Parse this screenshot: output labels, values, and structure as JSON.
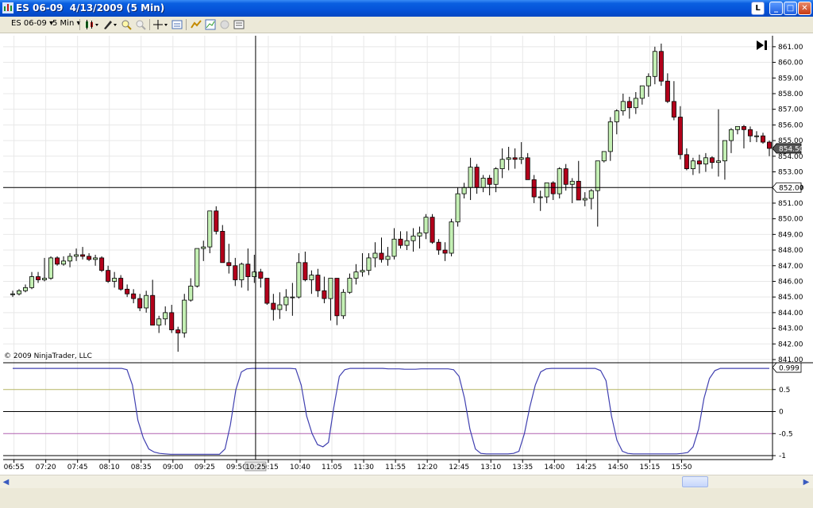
{
  "window": {
    "title": "ES 06-09  4/13/2009 (5 Min)",
    "button_l": "L",
    "minimize": "_",
    "maximize": "□",
    "close": "✕"
  },
  "toolbar": {
    "instrument": "ES 06-09",
    "interval": "5 Min",
    "icons": [
      "chart-style-icon",
      "drawing-pencil-icon",
      "zoom-in-icon",
      "zoom-out-icon",
      "crosshair-icon",
      "data-box-icon",
      "indicators-icon",
      "strategies-icon",
      "chart-trader-icon",
      "properties-icon"
    ]
  },
  "chart": {
    "copyright": "© 2009 NinjaTrader, LLC",
    "price_axis_labels": [
      "861.00",
      "860.00",
      "859.00",
      "858.00",
      "857.00",
      "856.00",
      "855.00",
      "854.00",
      "853.00",
      "852.00",
      "851.00",
      "850.00",
      "849.00",
      "848.00",
      "847.00",
      "846.00",
      "845.00",
      "844.00",
      "843.00",
      "842.00",
      "841.00"
    ],
    "last_price_label": "854.50",
    "crosshair_price_label": "852.00",
    "crosshair_time_label": "10:25",
    "time_labels": [
      "06:55",
      "07:20",
      "07:45",
      "08:10",
      "08:35",
      "09:00",
      "09:25",
      "09:50",
      "10:15",
      "10:40",
      "11:05",
      "11:30",
      "11:55",
      "12:20",
      "12:45",
      "13:10",
      "13:35",
      "14:00",
      "14:25",
      "14:50",
      "15:15",
      "15:50"
    ],
    "indicator_labels": [
      "0.999",
      "0.5",
      "0",
      "-0.5",
      "-1"
    ],
    "colors": {
      "up": "#c4f0b4",
      "down": "#b3001b",
      "indicator": "#4040b0",
      "level_high": "#b5b565",
      "level_low": "#b060b0",
      "grid": "#e8e8e8"
    }
  },
  "chart_data": {
    "type": "candlestick",
    "ohlc": [
      [
        845.2,
        845.4,
        845.0,
        845.2
      ],
      [
        845.2,
        845.5,
        845.1,
        845.4
      ],
      [
        845.4,
        845.8,
        845.3,
        845.6
      ],
      [
        845.6,
        846.6,
        845.5,
        846.3
      ],
      [
        846.3,
        846.6,
        845.9,
        846.1
      ],
      [
        846.1,
        847.5,
        846.0,
        846.2
      ],
      [
        846.2,
        847.6,
        846.1,
        847.5
      ],
      [
        847.5,
        847.6,
        847.0,
        847.1
      ],
      [
        847.1,
        847.6,
        847.0,
        847.3
      ],
      [
        847.3,
        847.8,
        846.9,
        847.6
      ],
      [
        847.6,
        848.1,
        847.3,
        847.7
      ],
      [
        847.7,
        848.2,
        847.4,
        847.6
      ],
      [
        847.6,
        847.8,
        847.3,
        847.4
      ],
      [
        847.4,
        847.7,
        847.0,
        847.5
      ],
      [
        847.5,
        847.6,
        846.6,
        846.7
      ],
      [
        846.7,
        847.0,
        845.9,
        846.0
      ],
      [
        846.0,
        846.6,
        845.6,
        846.2
      ],
      [
        846.2,
        846.4,
        845.4,
        845.5
      ],
      [
        845.5,
        845.8,
        845.0,
        845.2
      ],
      [
        845.2,
        845.5,
        844.6,
        844.9
      ],
      [
        844.9,
        845.2,
        844.1,
        844.3
      ],
      [
        844.3,
        845.4,
        844.0,
        845.1
      ],
      [
        845.1,
        846.1,
        843.2,
        843.2
      ],
      [
        843.2,
        843.8,
        842.7,
        843.6
      ],
      [
        843.6,
        844.4,
        843.2,
        844.0
      ],
      [
        844.0,
        844.5,
        842.7,
        842.9
      ],
      [
        842.9,
        843.1,
        841.5,
        842.7
      ],
      [
        842.7,
        845.2,
        842.4,
        844.8
      ],
      [
        844.8,
        846.2,
        844.7,
        845.7
      ],
      [
        845.7,
        848.1,
        845.6,
        848.1
      ],
      [
        848.1,
        848.6,
        847.3,
        848.2
      ],
      [
        848.2,
        850.2,
        847.8,
        850.5
      ],
      [
        850.5,
        850.8,
        849.0,
        849.2
      ],
      [
        849.2,
        849.6,
        847.3,
        847.2
      ],
      [
        847.2,
        848.4,
        846.5,
        847.0
      ],
      [
        847.0,
        847.5,
        845.7,
        846.1
      ],
      [
        846.1,
        847.2,
        845.6,
        847.1
      ],
      [
        847.1,
        848.1,
        845.4,
        846.3
      ],
      [
        846.3,
        847.7,
        845.9,
        846.6
      ],
      [
        846.6,
        846.8,
        845.6,
        846.2
      ],
      [
        846.2,
        846.2,
        844.5,
        844.6
      ],
      [
        844.6,
        845.2,
        843.5,
        844.2
      ],
      [
        844.2,
        845.3,
        843.6,
        844.5
      ],
      [
        844.5,
        845.5,
        844.1,
        845.0
      ],
      [
        845.0,
        845.9,
        843.8,
        845.0
      ],
      [
        845.0,
        847.8,
        844.9,
        847.2
      ],
      [
        847.2,
        847.9,
        846.0,
        846.1
      ],
      [
        846.1,
        846.7,
        845.2,
        846.4
      ],
      [
        846.4,
        846.8,
        845.0,
        845.4
      ],
      [
        845.4,
        846.3,
        844.6,
        844.9
      ],
      [
        844.9,
        846.2,
        843.5,
        846.2
      ],
      [
        846.2,
        846.2,
        843.2,
        843.8
      ],
      [
        843.8,
        845.5,
        843.6,
        845.3
      ],
      [
        845.3,
        846.5,
        845.2,
        846.2
      ],
      [
        846.2,
        847.1,
        845.8,
        846.6
      ],
      [
        846.6,
        847.8,
        846.3,
        846.7
      ],
      [
        846.7,
        847.8,
        846.4,
        847.5
      ],
      [
        847.5,
        848.5,
        846.9,
        847.8
      ],
      [
        847.8,
        848.8,
        847.2,
        847.4
      ],
      [
        847.4,
        848.2,
        847.0,
        847.6
      ],
      [
        847.6,
        849.4,
        847.4,
        848.7
      ],
      [
        848.7,
        849.2,
        848.1,
        848.3
      ],
      [
        848.3,
        849.2,
        848.0,
        848.6
      ],
      [
        848.6,
        849.4,
        847.9,
        848.9
      ],
      [
        848.9,
        849.5,
        848.1,
        849.1
      ],
      [
        849.1,
        850.3,
        848.7,
        850.1
      ],
      [
        850.1,
        850.3,
        848.4,
        848.5
      ],
      [
        848.5,
        848.7,
        847.7,
        848.0
      ],
      [
        848.0,
        848.5,
        847.3,
        847.8
      ],
      [
        847.8,
        850.0,
        847.6,
        849.8
      ],
      [
        849.8,
        852.0,
        849.5,
        851.6
      ],
      [
        851.6,
        852.3,
        851.3,
        852.0
      ],
      [
        852.0,
        853.9,
        851.2,
        853.3
      ],
      [
        853.3,
        853.5,
        851.6,
        852.0
      ],
      [
        852.0,
        852.8,
        851.7,
        852.6
      ],
      [
        852.6,
        852.8,
        851.5,
        852.2
      ],
      [
        852.2,
        853.3,
        851.7,
        853.2
      ],
      [
        853.2,
        854.5,
        852.6,
        853.8
      ],
      [
        853.8,
        854.6,
        853.1,
        853.9
      ],
      [
        853.9,
        854.5,
        853.2,
        853.8
      ],
      [
        853.8,
        854.9,
        853.5,
        853.9
      ],
      [
        853.9,
        854.2,
        852.5,
        852.5
      ],
      [
        852.5,
        852.8,
        851.0,
        851.4
      ],
      [
        851.4,
        851.8,
        850.5,
        851.4
      ],
      [
        851.4,
        852.3,
        851.0,
        852.3
      ],
      [
        852.3,
        852.4,
        851.2,
        851.6
      ],
      [
        851.6,
        853.3,
        851.3,
        853.2
      ],
      [
        853.2,
        853.5,
        851.8,
        852.2
      ],
      [
        852.2,
        852.6,
        851.0,
        852.4
      ],
      [
        852.4,
        853.7,
        851.6,
        851.2
      ],
      [
        851.2,
        851.7,
        850.8,
        851.3
      ],
      [
        851.3,
        851.9,
        850.6,
        851.8
      ],
      [
        851.8,
        852.3,
        849.5,
        853.7
      ],
      [
        853.7,
        854.3,
        853.6,
        854.3
      ],
      [
        854.3,
        856.5,
        853.7,
        856.2
      ],
      [
        856.2,
        857.0,
        855.4,
        856.9
      ],
      [
        856.9,
        858.0,
        856.6,
        857.5
      ],
      [
        857.5,
        857.8,
        856.4,
        857.1
      ],
      [
        857.1,
        858.1,
        856.7,
        857.7
      ],
      [
        857.7,
        858.5,
        857.3,
        858.5
      ],
      [
        858.5,
        859.3,
        857.8,
        859.1
      ],
      [
        859.1,
        861.0,
        858.6,
        860.7
      ],
      [
        860.7,
        861.2,
        858.5,
        858.8
      ],
      [
        858.8,
        859.3,
        857.4,
        857.5
      ],
      [
        857.5,
        858.8,
        856.3,
        856.5
      ],
      [
        856.5,
        857.2,
        853.8,
        854.1
      ],
      [
        854.1,
        854.5,
        853.1,
        853.2
      ],
      [
        853.2,
        853.9,
        852.8,
        853.7
      ],
      [
        853.7,
        854.1,
        852.9,
        853.5
      ],
      [
        853.5,
        854.2,
        853.0,
        853.9
      ],
      [
        853.9,
        854.0,
        853.2,
        853.6
      ],
      [
        853.6,
        857.0,
        852.7,
        853.7
      ],
      [
        853.7,
        854.9,
        852.5,
        855.0
      ],
      [
        855.0,
        855.8,
        854.2,
        855.7
      ],
      [
        855.7,
        855.9,
        855.4,
        855.9
      ],
      [
        855.9,
        856.0,
        854.5,
        855.7
      ],
      [
        855.7,
        855.9,
        854.9,
        855.3
      ],
      [
        855.3,
        855.6,
        854.9,
        855.3
      ],
      [
        855.3,
        855.5,
        854.8,
        854.9
      ],
      [
        854.9,
        855.0,
        854.0,
        854.5
      ]
    ],
    "indicator": [
      0.98,
      0.98,
      0.98,
      0.98,
      0.98,
      0.98,
      0.98,
      0.98,
      0.98,
      0.98,
      0.98,
      0.98,
      0.98,
      0.98,
      0.98,
      0.98,
      0.98,
      0.98,
      0.98,
      0.98,
      0.98,
      0.95,
      0.6,
      -0.2,
      -0.6,
      -0.85,
      -0.92,
      -0.95,
      -0.96,
      -0.97,
      -0.97,
      -0.97,
      -0.97,
      -0.97,
      -0.97,
      -0.97,
      -0.97,
      -0.97,
      -0.97,
      -0.85,
      -0.3,
      0.5,
      0.9,
      0.97,
      0.98,
      0.98,
      0.98,
      0.98,
      0.98,
      0.98,
      0.98,
      0.98,
      0.97,
      0.6,
      -0.1,
      -0.5,
      -0.75,
      -0.8,
      -0.7,
      0.1,
      0.8,
      0.95,
      0.98,
      0.98,
      0.98,
      0.98,
      0.98,
      0.98,
      0.98,
      0.97,
      0.97,
      0.97,
      0.96,
      0.96,
      0.96,
      0.97,
      0.97,
      0.97,
      0.97,
      0.97,
      0.97,
      0.95,
      0.8,
      0.3,
      -0.4,
      -0.85,
      -0.95,
      -0.96,
      -0.96,
      -0.96,
      -0.96,
      -0.96,
      -0.95,
      -0.9,
      -0.5,
      0.1,
      0.6,
      0.9,
      0.97,
      0.98,
      0.98,
      0.98,
      0.98,
      0.98,
      0.98,
      0.98,
      0.98,
      0.98,
      0.93,
      0.7,
      -0.1,
      -0.65,
      -0.9,
      -0.95,
      -0.96,
      -0.96,
      -0.96,
      -0.96,
      -0.96,
      -0.96,
      -0.96,
      -0.96,
      -0.96,
      -0.95,
      -0.93,
      -0.8,
      -0.4,
      0.3,
      0.75,
      0.93,
      0.98,
      0.98,
      0.98,
      0.98,
      0.98,
      0.98,
      0.98,
      0.98,
      0.98,
      0.98
    ],
    "price_range": [
      841,
      861.5
    ],
    "indicator_range": [
      -1,
      1
    ]
  }
}
